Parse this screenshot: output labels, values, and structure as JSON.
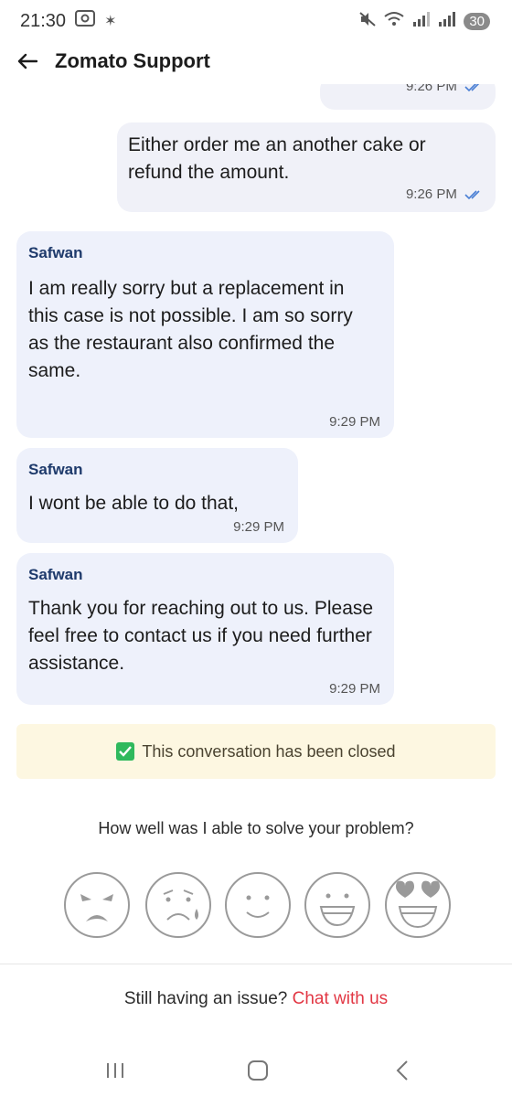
{
  "status_bar": {
    "time": "21:30",
    "battery": "30",
    "icons": [
      "screenshot-icon",
      "settings-icon",
      "mute-icon",
      "wifi-icon",
      "signal-icon",
      "signal-icon",
      "battery-icon"
    ]
  },
  "header": {
    "title": "Zomato Support"
  },
  "messages": [
    {
      "type": "out",
      "text": "",
      "time": "9:26 PM"
    },
    {
      "type": "out",
      "text": "Either order me an another cake or refund the amount.",
      "time": "9:26 PM"
    },
    {
      "type": "in",
      "sender": "Safwan",
      "text": "I am really sorry but a replacement in this case is not possible. I am so sorry as the restaurant also confirmed the same.",
      "time": "9:29 PM"
    },
    {
      "type": "in",
      "sender": "Safwan",
      "text": "I wont be able to do that,",
      "time": "9:29 PM"
    },
    {
      "type": "in",
      "sender": "Safwan",
      "text": "Thank you for reaching out to us. Please feel free to contact us if you need further assistance.",
      "time": "9:29 PM"
    }
  ],
  "closed_banner": {
    "text": "This conversation has been closed"
  },
  "rating": {
    "question": "How well was I able to solve your problem?",
    "faces": [
      "angry-face-icon",
      "sad-face-icon",
      "neutral-smile-face-icon",
      "happy-face-icon",
      "love-face-icon"
    ]
  },
  "footer": {
    "prefix": "Still having an issue?",
    "link": "Chat with us",
    "link_color": "#e23744"
  },
  "colors": {
    "sender": "#1e3a6b",
    "banner_bg": "#fdf7e1",
    "bubble_bg": "#eef1fb",
    "tick": "#4a7fd4"
  }
}
